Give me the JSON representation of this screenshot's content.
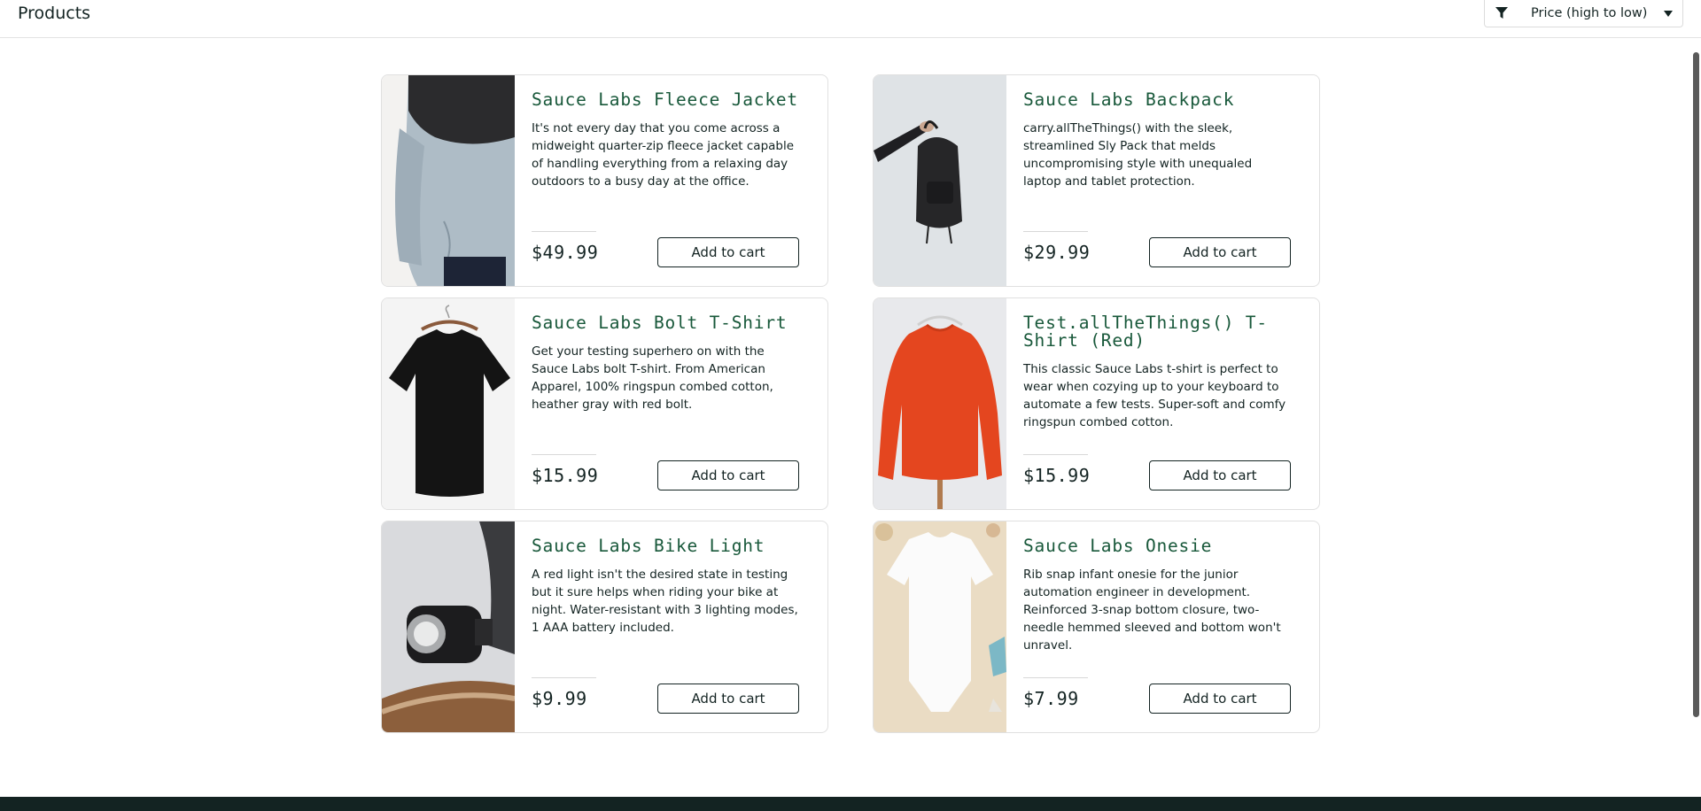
{
  "header": {
    "title": "Products",
    "sort": {
      "icon": "filter-icon",
      "selected": "Price (high to low)",
      "caret_icon": "chevron-down-icon"
    }
  },
  "products": [
    {
      "name": "Sauce Labs Fleece Jacket",
      "description": "It's not every day that you come across a midweight quarter-zip fleece jacket capable of handling everything from a relaxing day outdoors to a busy day at the office.",
      "price": "$49.99",
      "button": "Add to cart",
      "image": "fleece-jacket-image"
    },
    {
      "name": "Sauce Labs Backpack",
      "description": "carry.allTheThings() with the sleek, streamlined Sly Pack that melds uncompromising style with unequaled laptop and tablet protection.",
      "price": "$29.99",
      "button": "Add to cart",
      "image": "backpack-image"
    },
    {
      "name": "Sauce Labs Bolt T-Shirt",
      "description": "Get your testing superhero on with the Sauce Labs bolt T-shirt. From American Apparel, 100% ringspun combed cotton, heather gray with red bolt.",
      "price": "$15.99",
      "button": "Add to cart",
      "image": "bolt-tshirt-image"
    },
    {
      "name": "Test.allTheThings() T-Shirt (Red)",
      "description": "This classic Sauce Labs t-shirt is perfect to wear when cozying up to your keyboard to automate a few tests. Super-soft and comfy ringspun combed cotton.",
      "price": "$15.99",
      "button": "Add to cart",
      "image": "red-tshirt-image"
    },
    {
      "name": "Sauce Labs Bike Light",
      "description": "A red light isn't the desired state in testing but it sure helps when riding your bike at night. Water-resistant with 3 lighting modes, 1 AAA battery included.",
      "price": "$9.99",
      "button": "Add to cart",
      "image": "bike-light-image"
    },
    {
      "name": "Sauce Labs Onesie",
      "description": "Rib snap infant onesie for the junior automation engineer in development. Reinforced 3-snap bottom closure, two-needle hemmed sleeved and bottom won't unravel.",
      "price": "$7.99",
      "button": "Add to cart",
      "image": "onesie-image"
    }
  ],
  "colors": {
    "title": "#18583a",
    "text": "#132322",
    "footer": "#132322"
  }
}
